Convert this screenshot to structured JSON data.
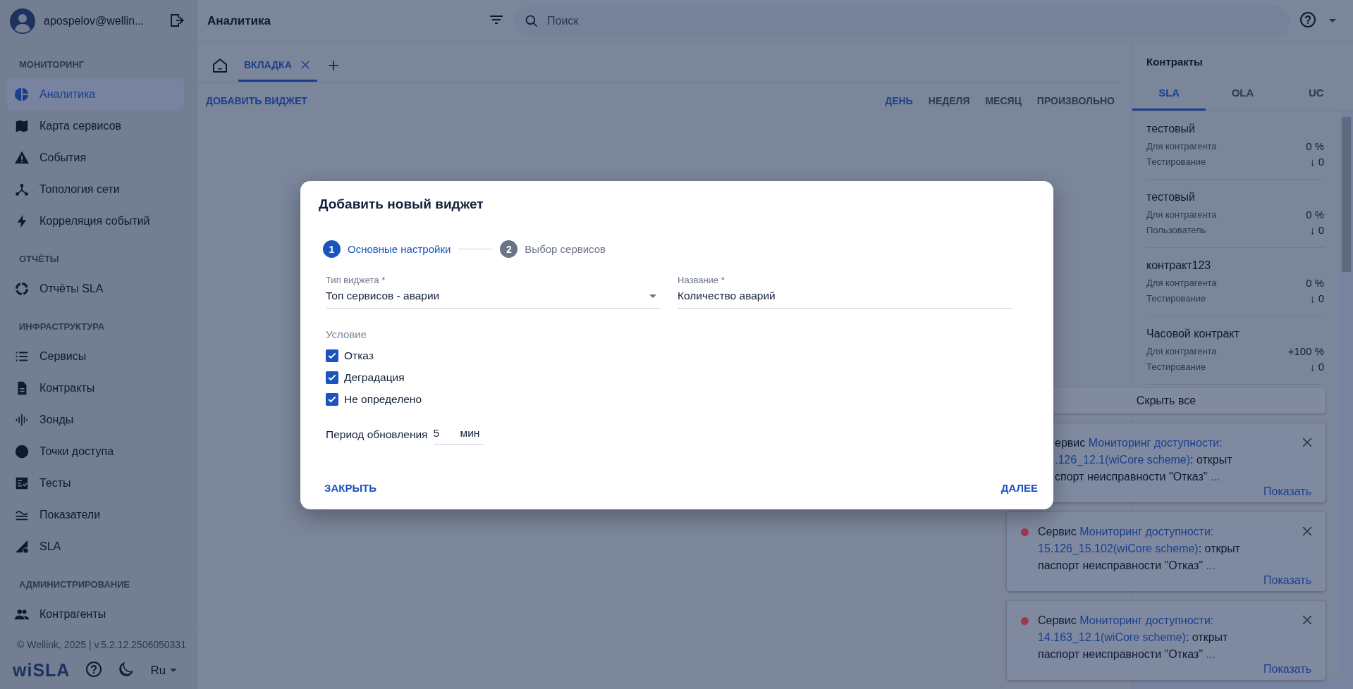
{
  "user": {
    "name": "apospelov@wellin..."
  },
  "sidebar": {
    "sections": [
      {
        "title": "МОНИТОРИНГ",
        "items": [
          {
            "label": "Аналитика",
            "selected": true
          },
          {
            "label": "Карта сервисов",
            "selected": false
          },
          {
            "label": "События",
            "selected": false
          },
          {
            "label": "Топология сети",
            "selected": false
          },
          {
            "label": "Корреляция событий",
            "selected": false
          }
        ]
      },
      {
        "title": "ОТЧЁТЫ",
        "items": [
          {
            "label": "Отчёты SLA",
            "selected": false
          }
        ]
      },
      {
        "title": "ИНФРАСТРУКТУРА",
        "items": [
          {
            "label": "Сервисы",
            "selected": false
          },
          {
            "label": "Контракты",
            "selected": false
          },
          {
            "label": "Зонды",
            "selected": false
          },
          {
            "label": "Точки доступа",
            "selected": false
          },
          {
            "label": "Тесты",
            "selected": false
          },
          {
            "label": "Показатели",
            "selected": false
          },
          {
            "label": "SLA",
            "selected": false
          }
        ]
      },
      {
        "title": "АДМИНИСТРИРОВАНИЕ",
        "items": [
          {
            "label": "Контрагенты",
            "selected": false
          }
        ]
      }
    ],
    "copyright": "© Wellink, 2025 | v.5.2.12.2506050331",
    "logo": "wiSLA",
    "language": "Ru"
  },
  "top_bar": {
    "title": "Аналитика",
    "search": {
      "placeholder": "Поиск"
    }
  },
  "tabs": [
    {
      "label": "ВКЛАДКА",
      "selected": true
    }
  ],
  "toolbar": {
    "add_widget": "ДОБАВИТЬ ВИДЖЕТ",
    "periods": [
      {
        "label": "ДЕНЬ",
        "selected": true
      },
      {
        "label": "НЕДЕЛЯ",
        "selected": false
      },
      {
        "label": "МЕСЯЦ",
        "selected": false
      },
      {
        "label": "ПРОИЗВОЛЬНО",
        "selected": false
      }
    ]
  },
  "contracts": {
    "title": "Контракты",
    "tabs": [
      {
        "label": "SLA",
        "selected": true
      },
      {
        "label": "OLA",
        "selected": false
      },
      {
        "label": "UC",
        "selected": false
      }
    ],
    "items": [
      {
        "name": "тестовый",
        "rows": [
          {
            "label": "Для контрагента",
            "value": "0 %"
          },
          {
            "label": "Тестирование",
            "value": "↓ 0"
          }
        ]
      },
      {
        "name": "тестовый",
        "rows": [
          {
            "label": "Для контрагента",
            "value": "0 %"
          },
          {
            "label": "Пользователь",
            "value": "↓ 0"
          }
        ]
      },
      {
        "name": "контракт123",
        "rows": [
          {
            "label": "Для контрагента",
            "value": "0 %"
          },
          {
            "label": "Тестирование",
            "value": "↓ 0"
          }
        ]
      },
      {
        "name": "Часовой контракт",
        "rows": [
          {
            "label": "Для контрагента",
            "value": "+100 %"
          },
          {
            "label": "Тестирование",
            "value": "↓ 0"
          }
        ]
      }
    ]
  },
  "notifications": {
    "hide_all": "Скрыть все",
    "items": [
      {
        "kind": "partial",
        "lines": [
          [
            {
              "text": "ервис ",
              "link": false
            },
            {
              "text": "Мониторинг доступности:",
              "link": true
            }
          ],
          [
            {
              "text": ".126_12.1(wiCore scheme)",
              "link": true
            },
            {
              "text": ": открыт",
              "link": false
            }
          ],
          [
            {
              "text": "спорт неисправности \"Отказ\" ",
              "link": false
            },
            {
              "text": "...",
              "link": true
            }
          ]
        ],
        "action": "Показать"
      },
      {
        "kind": "full",
        "color": "#9c3a4c",
        "lines": [
          [
            {
              "text": "Сервис ",
              "link": false
            },
            {
              "text": "Мониторинг доступности:",
              "link": true
            }
          ],
          [
            {
              "text": "15.126_15.102(wiCore scheme)",
              "link": true
            },
            {
              "text": ": открыт",
              "link": false
            }
          ],
          [
            {
              "text": "паспорт неисправности \"Отказ\" ",
              "link": false
            },
            {
              "text": "...",
              "link": true
            }
          ]
        ],
        "action": "Показать"
      },
      {
        "kind": "full",
        "color": "#9c3a4c",
        "lines": [
          [
            {
              "text": "Сервис ",
              "link": false
            },
            {
              "text": "Мониторинг доступности:",
              "link": true
            }
          ],
          [
            {
              "text": "14.163_12.1(wiCore scheme)",
              "link": true
            },
            {
              "text": ": открыт",
              "link": false
            }
          ],
          [
            {
              "text": "паспорт неисправности \"Отказ\" ",
              "link": false
            },
            {
              "text": "...",
              "link": true
            }
          ]
        ],
        "action": "Показать"
      }
    ]
  },
  "dialog": {
    "title": "Добавить новый виджет",
    "steps": [
      {
        "number": "1",
        "label": "Основные настройки",
        "selected": true
      },
      {
        "number": "2",
        "label": "Выбор сервисов",
        "selected": false
      }
    ],
    "widget_type": {
      "label": "Тип виджета *",
      "value": "Топ сервисов - аварии"
    },
    "name": {
      "label": "Название *",
      "value": "Количество аварий"
    },
    "condition": {
      "label": "Условие",
      "options": [
        {
          "label": "Отказ",
          "checked": true
        },
        {
          "label": "Деградация",
          "checked": true
        },
        {
          "label": "Не определено",
          "checked": true
        }
      ]
    },
    "refresh": {
      "label": "Период обновления",
      "value": "5",
      "unit": "мин"
    },
    "buttons": {
      "close": "ЗАКРЫТЬ",
      "next": "ДАЛЕЕ"
    }
  }
}
